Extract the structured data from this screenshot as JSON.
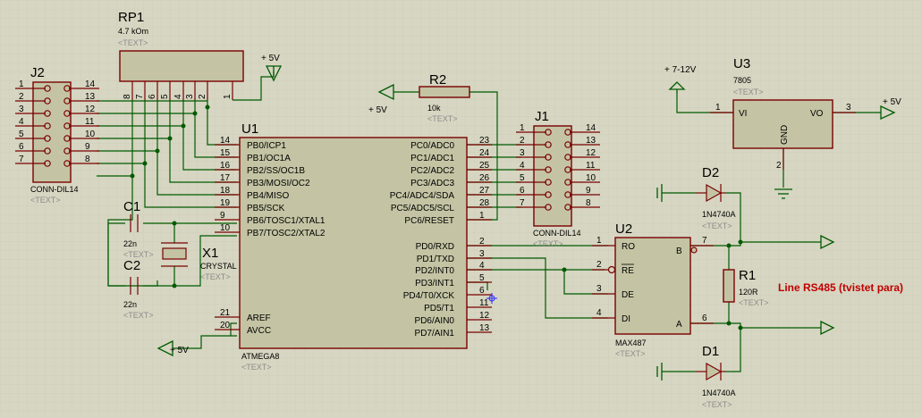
{
  "placeholder": "<TEXT>",
  "colors": {
    "background": "#d6d6c2",
    "grid": "#c8c8b2",
    "component_body": "#c4c4a4",
    "component_outline": "#7a0000",
    "wire": "#005a00",
    "note": "#c00000"
  },
  "components": {
    "rp1": {
      "ref": "RP1",
      "value": "4.7 kOm",
      "pins": [
        "8",
        "7",
        "6",
        "5",
        "4",
        "3",
        "2",
        "1"
      ]
    },
    "u1": {
      "ref": "U1",
      "value": "ATMEGA8",
      "left_pins": [
        {
          "num": "14",
          "name": "PB0/ICP1"
        },
        {
          "num": "15",
          "name": "PB1/OC1A"
        },
        {
          "num": "16",
          "name": "PB2/SS/OC1B"
        },
        {
          "num": "17",
          "name": "PB3/MOSI/OC2"
        },
        {
          "num": "18",
          "name": "PB4/MISO"
        },
        {
          "num": "19",
          "name": "PB5/SCK"
        },
        {
          "num": "9",
          "name": "PB6/TOSC1/XTAL1"
        },
        {
          "num": "10",
          "name": "PB7/TOSC2/XTAL2"
        },
        {
          "num": "21",
          "name": "AREF"
        },
        {
          "num": "20",
          "name": "AVCC"
        }
      ],
      "right_pins": [
        {
          "num": "23",
          "name": "PC0/ADC0"
        },
        {
          "num": "24",
          "name": "PC1/ADC1"
        },
        {
          "num": "25",
          "name": "PC2/ADC2"
        },
        {
          "num": "26",
          "name": "PC3/ADC3"
        },
        {
          "num": "27",
          "name": "PC4/ADC4/SDA"
        },
        {
          "num": "28",
          "name": "PC5/ADC5/SCL"
        },
        {
          "num": "1",
          "name": "PC6/RESET"
        },
        {
          "num": "2",
          "name": "PD0/RXD"
        },
        {
          "num": "3",
          "name": "PD1/TXD"
        },
        {
          "num": "4",
          "name": "PD2/INT0"
        },
        {
          "num": "5",
          "name": "PD3/INT1"
        },
        {
          "num": "6",
          "name": "PD4/T0/XCK"
        },
        {
          "num": "11",
          "name": "PD5/T1"
        },
        {
          "num": "12",
          "name": "PD6/AIN0"
        },
        {
          "num": "13",
          "name": "PD7/AIN1"
        }
      ]
    },
    "j2": {
      "ref": "J2",
      "value": "CONN-DIL14",
      "left_pins": [
        "1",
        "2",
        "3",
        "4",
        "5",
        "6",
        "7"
      ],
      "right_pins": [
        "14",
        "13",
        "12",
        "11",
        "10",
        "9",
        "8"
      ]
    },
    "j1": {
      "ref": "J1",
      "value": "CONN-DIL14",
      "left_pins": [
        "1",
        "2",
        "3",
        "4",
        "5",
        "6",
        "7"
      ],
      "right_pins": [
        "14",
        "13",
        "12",
        "11",
        "10",
        "9",
        "8"
      ]
    },
    "r2": {
      "ref": "R2",
      "value": "10k"
    },
    "r1": {
      "ref": "R1",
      "value": "120R"
    },
    "c1": {
      "ref": "C1",
      "value": "22n"
    },
    "c2": {
      "ref": "C2",
      "value": "22n"
    },
    "x1": {
      "ref": "X1",
      "value": "CRYSTAL"
    },
    "u2": {
      "ref": "U2",
      "value": "MAX487",
      "left_pins": [
        {
          "num": "1",
          "name": "RO"
        },
        {
          "num": "2",
          "name": "RE"
        },
        {
          "num": "3",
          "name": "DE"
        },
        {
          "num": "4",
          "name": "DI"
        }
      ],
      "right_pins": [
        {
          "num": "7",
          "name": "B"
        },
        {
          "num": "6",
          "name": "A"
        }
      ]
    },
    "u3": {
      "ref": "U3",
      "value": "7805",
      "pin_vi": "VI",
      "pin_vo": "VO",
      "pin_gnd": "GND",
      "num_vi": "1",
      "num_vo": "3",
      "num_gnd": "2"
    },
    "d1": {
      "ref": "D1",
      "value": "1N4740A"
    },
    "d2": {
      "ref": "D2",
      "value": "1N4740A"
    }
  },
  "power": {
    "rp1_vcc": "+ 5V",
    "r2_vcc": "+ 5V",
    "avcc_vcc": "+ 5V",
    "u3_in": "+ 7-12V",
    "u3_out": "+ 5V"
  },
  "note": "Line RS485 (tvistet para)"
}
